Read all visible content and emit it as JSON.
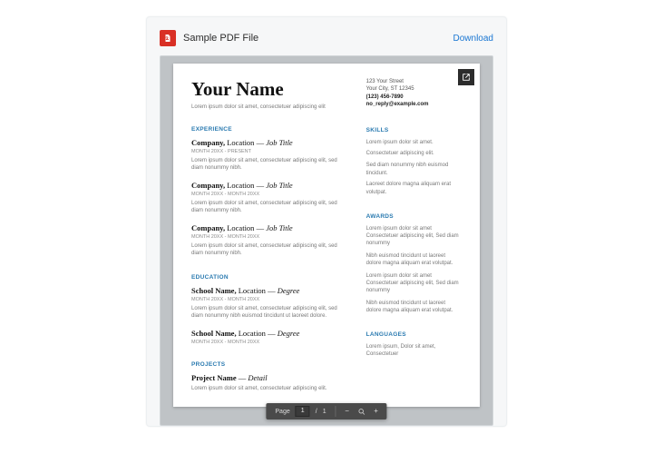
{
  "header": {
    "file_title": "Sample PDF File",
    "download_label": "Download"
  },
  "toolbar": {
    "page_label": "Page",
    "page_current": "1",
    "page_sep": "/",
    "page_total": "1"
  },
  "doc": {
    "name": "Your Name",
    "subtitle": "Lorem ipsum dolor sit amet, consectetuer adipiscing elit",
    "contact": {
      "line1": "123 Your Street",
      "line2": "Your City, ST 12345",
      "phone": "(123) 456-7890",
      "email": "no_reply@example.com"
    },
    "sections": {
      "experience_label": "EXPERIENCE",
      "education_label": "EDUCATION",
      "projects_label": "PROJECTS",
      "skills_label": "SKILLS",
      "awards_label": "AWARDS",
      "languages_label": "LANGUAGES"
    },
    "experience": [
      {
        "company": "Company,",
        "location": "Location",
        "dash": "—",
        "title": "Job Title",
        "dates": "MONTH 20XX - PRESENT",
        "body": "Lorem ipsum dolor sit amet, consectetuer adipiscing elit, sed diam nonummy nibh."
      },
      {
        "company": "Company,",
        "location": "Location",
        "dash": "—",
        "title": "Job Title",
        "dates": "MONTH 20XX - MONTH 20XX",
        "body": "Lorem ipsum dolor sit amet, consectetuer adipiscing elit, sed diam nonummy nibh."
      },
      {
        "company": "Company,",
        "location": "Location",
        "dash": "—",
        "title": "Job Title",
        "dates": "MONTH 20XX - MONTH 20XX",
        "body": "Lorem ipsum dolor sit amet, consectetuer adipiscing elit, sed diam nonummy nibh."
      }
    ],
    "education": [
      {
        "school": "School Name,",
        "location": "Location",
        "dash": "—",
        "degree": "Degree",
        "dates": "MONTH 20XX - MONTH 20XX",
        "body": "Lorem ipsum dolor sit amet, consectetuer adipiscing elit, sed diam nonummy nibh euismod tincidunt ut laoreet dolore."
      },
      {
        "school": "School Name,",
        "location": "Location",
        "dash": "—",
        "degree": "Degree",
        "dates": "MONTH 20XX - MONTH 20XX",
        "body": ""
      }
    ],
    "projects": [
      {
        "name": "Project Name",
        "dash": "—",
        "detail": "Detail",
        "body": "Lorem ipsum dolor sit amet, consectetuer adipiscing elit."
      }
    ],
    "skills": {
      "p1": "Lorem ipsum dolor sit amet.",
      "p2": "Consectetuer adipiscing elit.",
      "p3": "Sed diam nonummy nibh euismod tincidunt.",
      "p4": "Laoreet dolore magna aliquam erat volutpat."
    },
    "awards": {
      "p1": "Lorem ipsum dolor sit amet Consectetuer adipiscing elit, Sed diam nonummy",
      "p2": "Nibh euismod tincidunt ut laoreet dolore magna aliquam erat volutpat.",
      "p3": "Lorem ipsum dolor sit amet Consectetuer adipiscing elit, Sed diam nonummy",
      "p4": "Nibh euismod tincidunt ut laoreet dolore magna aliquam erat volutpat."
    },
    "languages": {
      "text": "Lorem ipsum, Dolor sit amet, Consectetuer"
    }
  }
}
